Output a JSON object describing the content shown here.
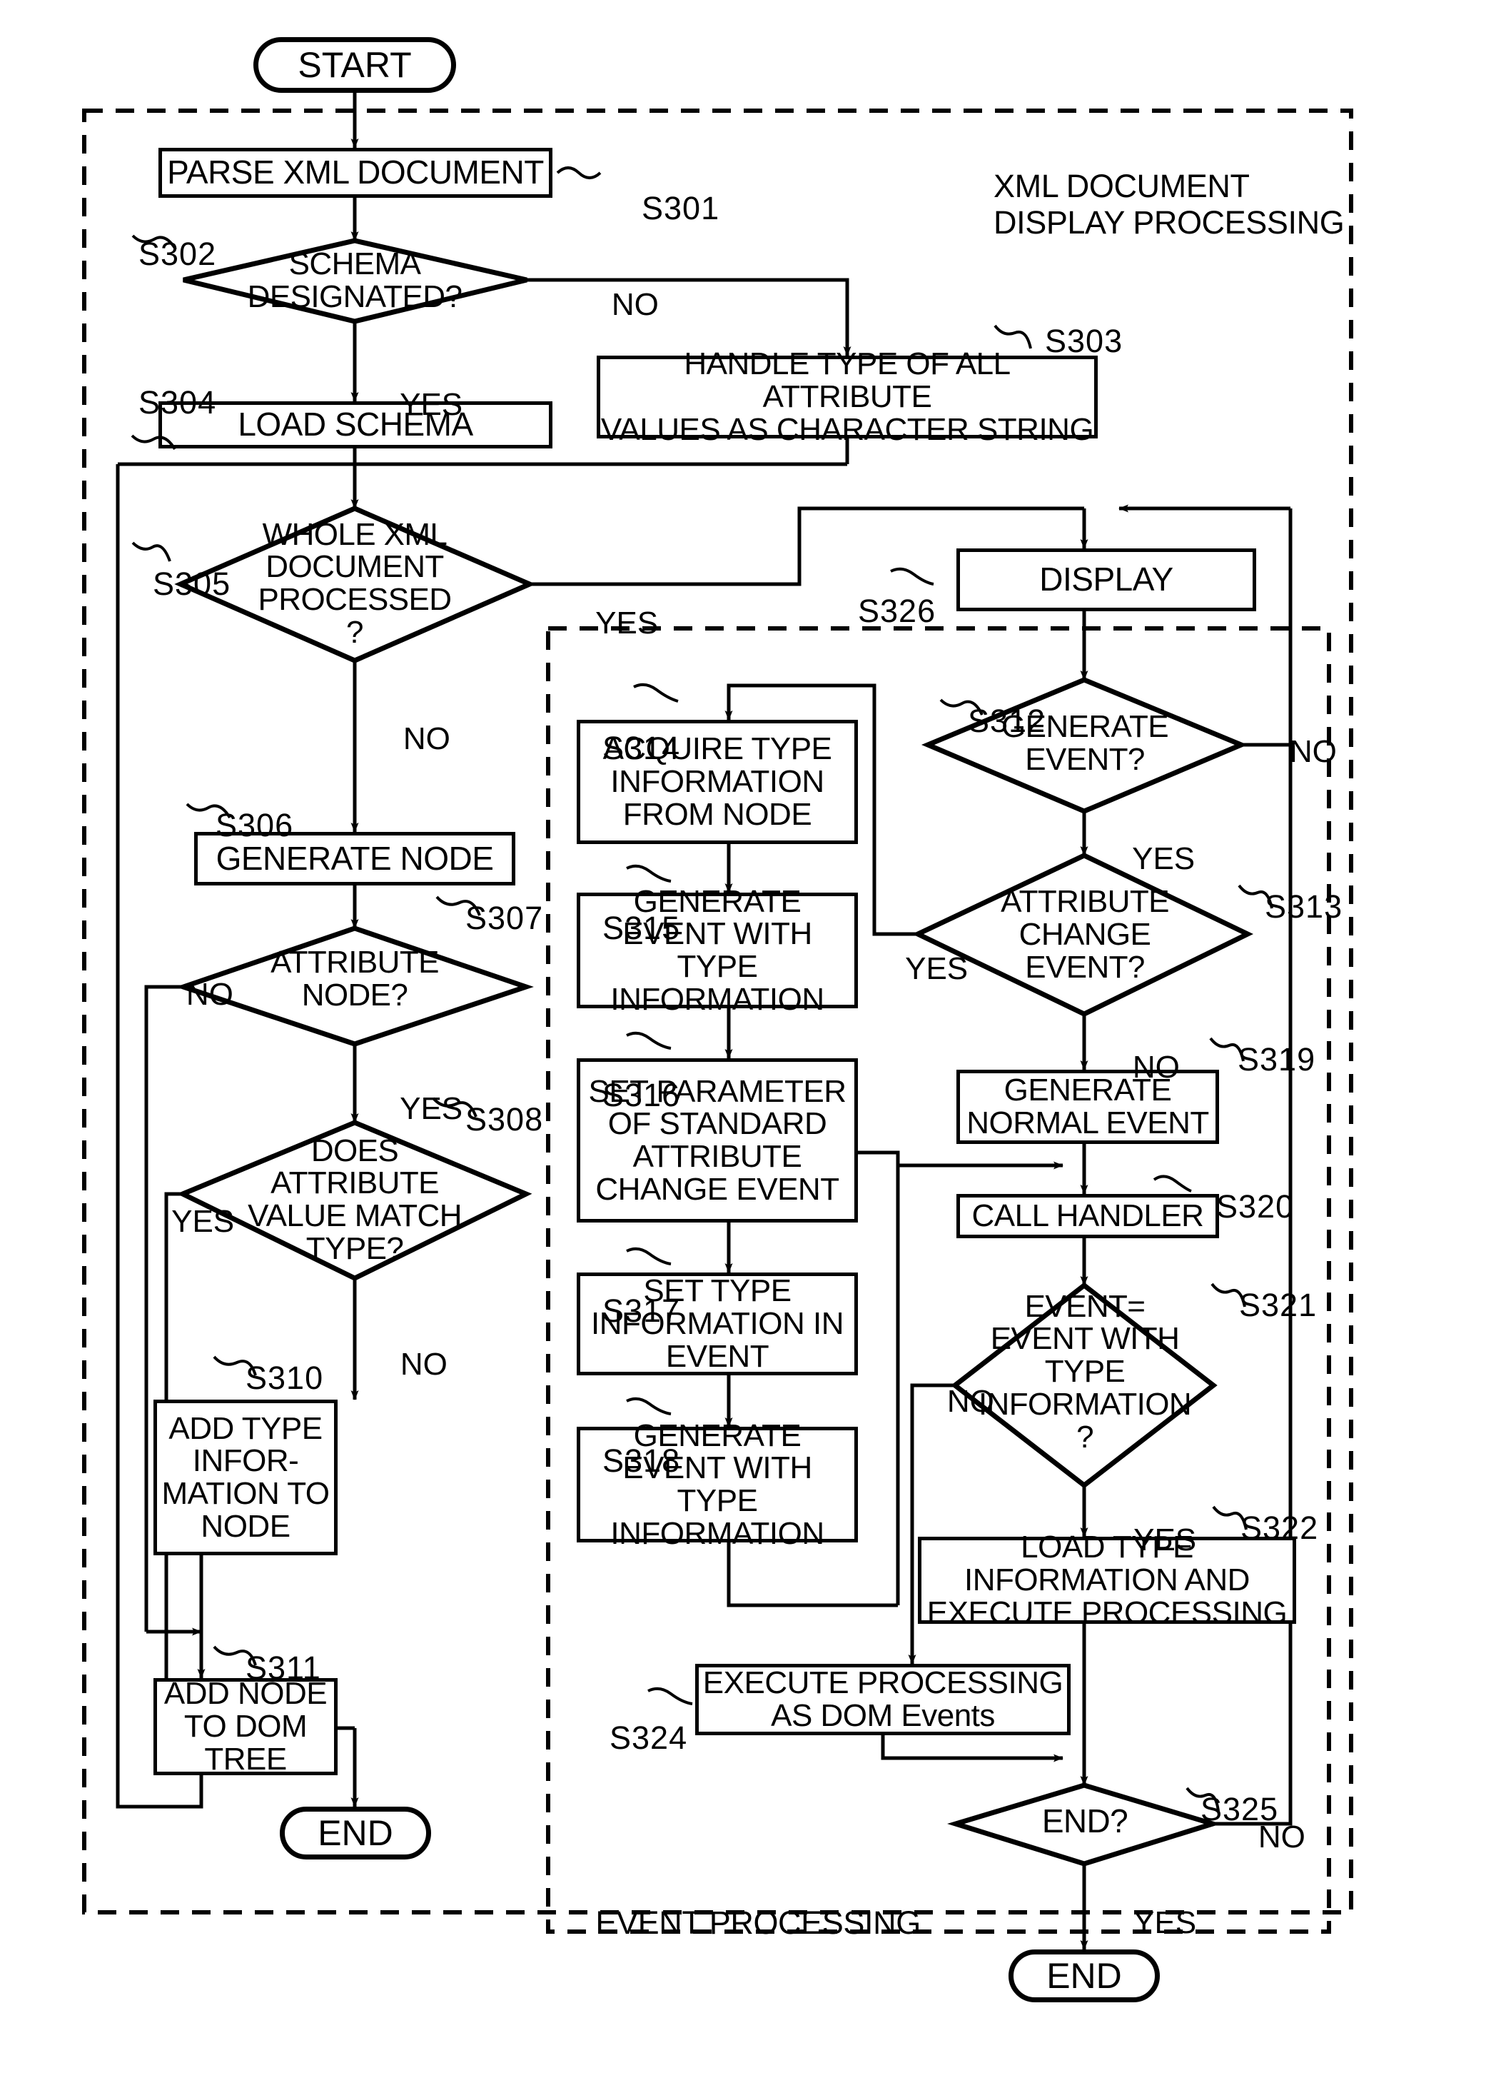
{
  "figure": {
    "kind": "patent-flowchart",
    "groups": [
      {
        "id": "xml-display",
        "label": "XML DOCUMENT\nDISPLAY PROCESSING"
      },
      {
        "id": "event-processing",
        "label": "EVENT PROCESSING"
      }
    ]
  },
  "terminals": {
    "start": "START",
    "end_left": "END",
    "end_right": "END"
  },
  "steps": {
    "s301": "S301",
    "s302": "S302",
    "s303": "S303",
    "s304": "S304",
    "s305": "S305",
    "s306": "S306",
    "s307": "S307",
    "s308": "S308",
    "s310": "S310",
    "s311": "S311",
    "s312": "S312",
    "s313": "S313",
    "s314": "S314",
    "s315": "S315",
    "s316": "S316",
    "s317": "S317",
    "s318": "S318",
    "s319": "S319",
    "s320": "S320",
    "s321": "S321",
    "s322": "S322",
    "s324": "S324",
    "s325": "S325",
    "s326": "S326"
  },
  "boxes": {
    "parse_xml": "PARSE XML DOCUMENT",
    "handle_type": "HANDLE TYPE OF ALL ATTRIBUTE\nVALUES AS CHARACTER STRING",
    "load_schema": "LOAD SCHEMA",
    "generate_node": "GENERATE NODE",
    "add_type_info": "ADD TYPE\nINFOR-\nMATION TO\nNODE",
    "add_node_dom": "ADD NODE\nTO DOM\nTREE",
    "display": "DISPLAY",
    "acquire_type": "ACQUIRE TYPE\nINFORMATION\nFROM NODE",
    "gen_event_type_315": "GENERATE\nEVENT WITH TYPE\nINFORMATION",
    "set_param": "SET PARAMETER\nOF STANDARD\nATTRIBUTE\nCHANGE EVENT",
    "set_type_info": "SET TYPE\nINFORMATION IN\nEVENT",
    "gen_event_type_318": "GENERATE\nEVENT WITH TYPE\nINFORMATION",
    "gen_normal_event": "GENERATE\nNORMAL EVENT",
    "call_handler": "CALL HANDLER",
    "load_type_exec": "LOAD TYPE\nINFORMATION AND\nEXECUTE PROCESSING",
    "exec_dom_events": "EXECUTE PROCESSING\nAS DOM Events"
  },
  "decisions": {
    "schema_designated": "SCHEMA\nDESIGNATED?",
    "whole_processed": "WHOLE XML\nDOCUMENT\nPROCESSED\n?",
    "attribute_node": "ATTRIBUTE\nNODE?",
    "value_match": "DOES\nATTRIBUTE\nVALUE MATCH\nTYPE?",
    "generate_event": "GENERATE\nEVENT?",
    "attr_change_event": "ATTRIBUTE\nCHANGE\nEVENT?",
    "event_with_type": "EVENT=\nEVENT WITH TYPE\nINFORMATION\n?",
    "end_q": "END?"
  },
  "branch_labels": {
    "s302_no": "NO",
    "s302_yes": "YES",
    "s305_yes": "YES",
    "s305_no": "NO",
    "s307_no": "NO",
    "s307_yes": "YES",
    "s308_yes": "YES",
    "s308_no": "NO",
    "s312_no": "NO",
    "s312_yes": "YES",
    "s313_yes": "YES",
    "s313_no": "NO",
    "s321_no": "NO",
    "s321_yes": "YES",
    "s325_no": "NO",
    "s325_yes": "YES"
  },
  "colors": {
    "ink": "#000000",
    "paper": "#ffffff"
  }
}
